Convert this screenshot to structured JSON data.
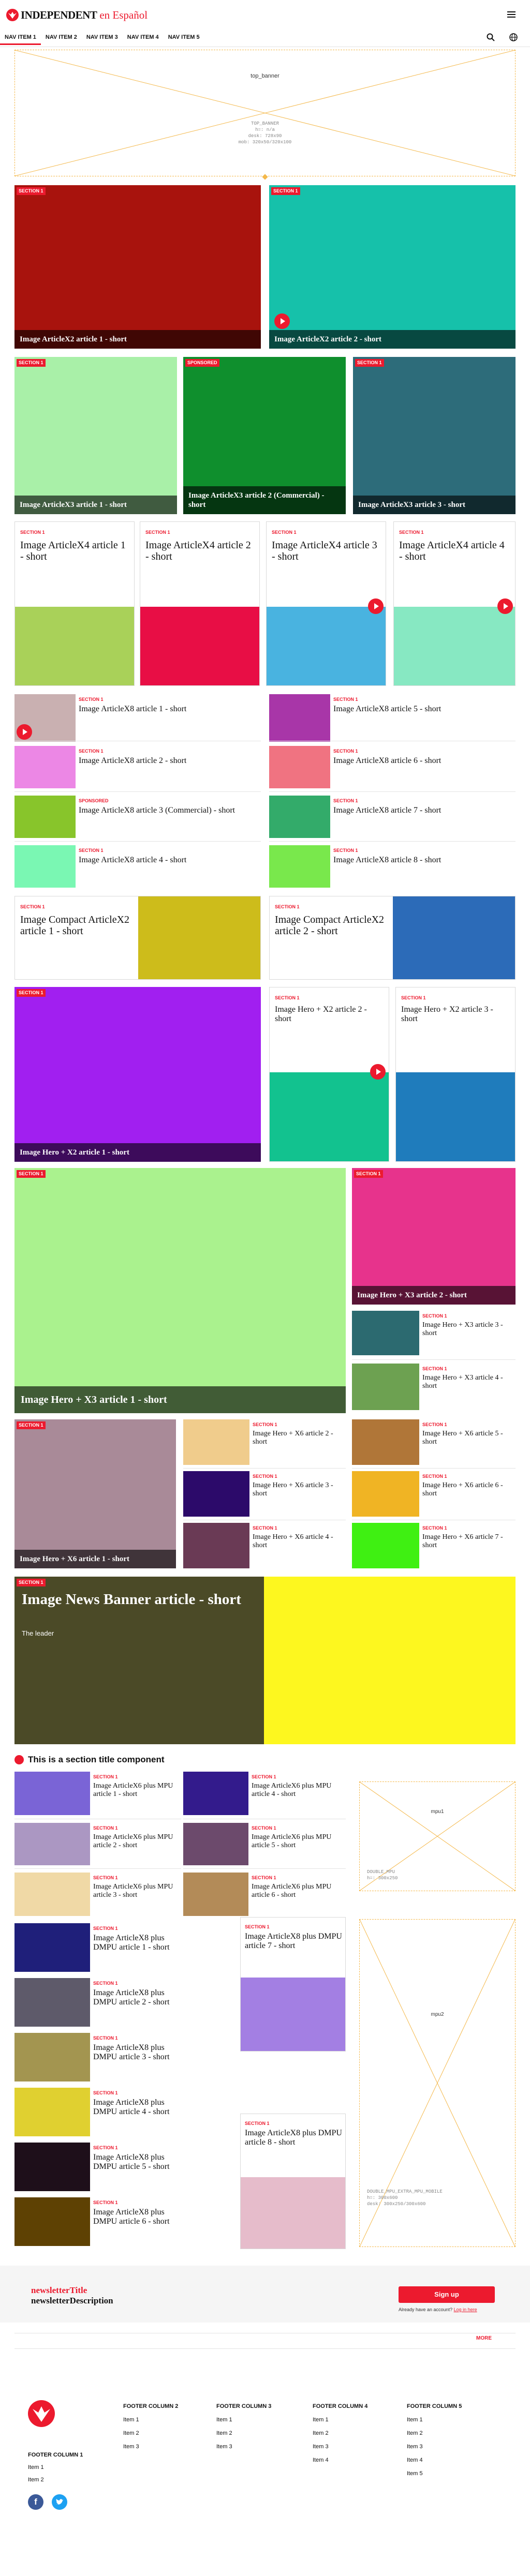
{
  "header": {
    "logo_word": "INDEPENDENT",
    "logo_suffix": "en Español",
    "nav": [
      "NAV ITEM 1",
      "NAV ITEM 2",
      "NAV ITEM 3",
      "NAV ITEM 4",
      "NAV ITEM 5"
    ]
  },
  "top_banner": {
    "label": "top_banner",
    "info_lines": [
      "TOP_BANNER",
      "h=: n/a",
      "desk: 728x90",
      "mob: 320x50/320x100"
    ]
  },
  "section_label": "SECTION 1",
  "sponsored_label": "SPONSORED",
  "x2": [
    {
      "title": "Image ArticleX2 article 1 - short",
      "color": "#a8130d"
    },
    {
      "title": "Image ArticleX2 article 2 - short",
      "color": "#16c1aa"
    }
  ],
  "x3": [
    {
      "title": "Image ArticleX3 article 1 - short",
      "color": "#a9f0a8",
      "label": "SECTION 1"
    },
    {
      "title": "Image ArticleX3 article 2 (Commercial) - short",
      "color": "#0f8f2d",
      "label": "SPONSORED"
    },
    {
      "title": "Image ArticleX3 article 3 - short",
      "color": "#2d6c7a",
      "label": "SECTION 1"
    }
  ],
  "x4": [
    {
      "title": "Image ArticleX4 article 1 - short",
      "color": "#a9d159"
    },
    {
      "title": "Image ArticleX4 article 2 - short",
      "color": "#e80e45"
    },
    {
      "title": "Image ArticleX4 article 3 - short",
      "color": "#49b3e0"
    },
    {
      "title": "Image ArticleX4 article 4 - short",
      "color": "#87e8c2"
    }
  ],
  "x8": [
    {
      "title": "Image ArticleX8 article 1 - short",
      "color": "#c9b0b1",
      "label": "SECTION 1"
    },
    {
      "title": "Image ArticleX8 article 2 - short",
      "color": "#ec87e5",
      "label": "SECTION 1"
    },
    {
      "title": "Image ArticleX8 article 3 (Commercial) - short",
      "color": "#88c52b",
      "label": "SPONSORED"
    },
    {
      "title": "Image ArticleX8 article 4 - short",
      "color": "#7af7b3",
      "label": "SECTION 1"
    },
    {
      "title": "Image ArticleX8 article 5 - short",
      "color": "#a836a8",
      "label": "SECTION 1"
    },
    {
      "title": "Image ArticleX8 article 6 - short",
      "color": "#f07381",
      "label": "SECTION 1"
    },
    {
      "title": "Image ArticleX8 article 7 - short",
      "color": "#33ab6a",
      "label": "SECTION 1"
    },
    {
      "title": "Image ArticleX8 article 8 - short",
      "color": "#79e84c",
      "label": "SECTION 1"
    }
  ],
  "compact": [
    {
      "title": "Image Compact ArticleX2 article 1 - short",
      "color": "#cdbc1b"
    },
    {
      "title": "Image Compact ArticleX2 article 2 - short",
      "color": "#2c6bb8"
    }
  ],
  "hero_x2": [
    {
      "title": "Image Hero + X2 article 1 - short",
      "color": "#a11ff0"
    },
    {
      "title": "Image Hero + X2 article 2 - short",
      "color": "#12c28f"
    },
    {
      "title": "Image Hero + X2 article 3 - short",
      "color": "#1f7cbc"
    }
  ],
  "hero_x3": [
    {
      "title": "Image Hero + X3 article 1 - short",
      "color": "#aaf28e"
    },
    {
      "title": "Image Hero + X3 article 2 - short",
      "color": "#e7338c"
    },
    {
      "title": "Image Hero + X3 article 3 - short",
      "color": "#2c6a70"
    },
    {
      "title": "Image Hero + X3 article 4 - short",
      "color": "#6da151"
    }
  ],
  "hero_x6": [
    {
      "title": "Image Hero + X6 article 1 - short",
      "color": "#a98a98"
    },
    {
      "title": "Image Hero + X6 article 2 - short",
      "color": "#f0cc8c"
    },
    {
      "title": "Image Hero + X6 article 3 - short",
      "color": "#2c0a6a"
    },
    {
      "title": "Image Hero + X6 article 4 - short",
      "color": "#6a3a55"
    },
    {
      "title": "Image Hero + X6 article 5 - short",
      "color": "#b07638"
    },
    {
      "title": "Image Hero + X6 article 6 - short",
      "color": "#f0b424"
    },
    {
      "title": "Image Hero + X6 article 7 - short",
      "color": "#3ff012"
    }
  ],
  "news_banner": {
    "label": "SECTION 1",
    "title": "Image News Banner article - short",
    "subtitle": "The leader",
    "color_dark": "#4b4a27",
    "color_image": "#fdf71f"
  },
  "section_title": "This is a section title component",
  "x6mpu": [
    {
      "title": "Image ArticleX6 plus MPU article 1 - short",
      "color": "#7a64d6"
    },
    {
      "title": "Image ArticleX6 plus MPU article 2 - short",
      "color": "#ab97c2"
    },
    {
      "title": "Image ArticleX6 plus MPU article 3 - short",
      "color": "#f0d9a6"
    },
    {
      "title": "Image ArticleX6 plus MPU article 4 - short",
      "color": "#331b8c"
    },
    {
      "title": "Image ArticleX6 plus MPU article 5 - short",
      "color": "#6c4a6c"
    },
    {
      "title": "Image ArticleX6 plus MPU article 6 - short",
      "color": "#b38b58"
    }
  ],
  "mpu1": {
    "label": "mpu1",
    "info_lines": [
      "DOUBLE_MPU",
      "h=: 300x250"
    ]
  },
  "x8dmpu": [
    {
      "title": "Image ArticleX8 plus DMPU article 1 - short",
      "color": "#1f1f7a"
    },
    {
      "title": "Image ArticleX8 plus DMPU article 2 - short",
      "color": "#5e5a6a"
    },
    {
      "title": "Image ArticleX8 plus DMPU article 3 - short",
      "color": "#a39550"
    },
    {
      "title": "Image ArticleX8 plus DMPU article 4 - short",
      "color": "#e0d030"
    },
    {
      "title": "Image ArticleX8 plus DMPU article 5 - short",
      "color": "#1e0f1a"
    },
    {
      "title": "Image ArticleX8 plus DMPU article 6 - short",
      "color": "#5e4103"
    },
    {
      "title": "Image ArticleX8 plus DMPU article 7 - short",
      "color": "#a37fe3"
    },
    {
      "title": "Image ArticleX8 plus DMPU article 8 - short",
      "color": "#e6bccb"
    }
  ],
  "mpu2": {
    "label": "mpu2",
    "info_lines": [
      "DOUBLE_MPU_EXTRA_MPU_MOBILE",
      "h=: 300x600",
      "desk: 300x250/300x600"
    ]
  },
  "newsletter": {
    "title": "newsletterTitle",
    "description": "newsletterDescription",
    "signup": "Sign up",
    "account_prefix": "Already have an account?",
    "login": "Log in here",
    "more": "MORE"
  },
  "footer": {
    "col1_title": "FOOTER COLUMN 1",
    "col1_items": [
      "Item 1",
      "Item 2"
    ],
    "columns": [
      {
        "title": "FOOTER COLUMN 2",
        "items": [
          "Item 1",
          "Item 2",
          "Item 3"
        ]
      },
      {
        "title": "FOOTER COLUMN 3",
        "items": [
          "Item 1",
          "Item 2",
          "Item 3"
        ]
      },
      {
        "title": "FOOTER COLUMN 4",
        "items": [
          "Item 1",
          "Item 2",
          "Item 3",
          "Item 4"
        ]
      },
      {
        "title": "FOOTER COLUMN 5",
        "items": [
          "Item 1",
          "Item 2",
          "Item 3",
          "Item 4",
          "Item 5"
        ]
      }
    ]
  },
  "colors": {
    "brand_red": "#ec1a2e",
    "facebook": "#3b5998",
    "twitter": "#1da1f2",
    "placeholder": "#f4b84a"
  }
}
